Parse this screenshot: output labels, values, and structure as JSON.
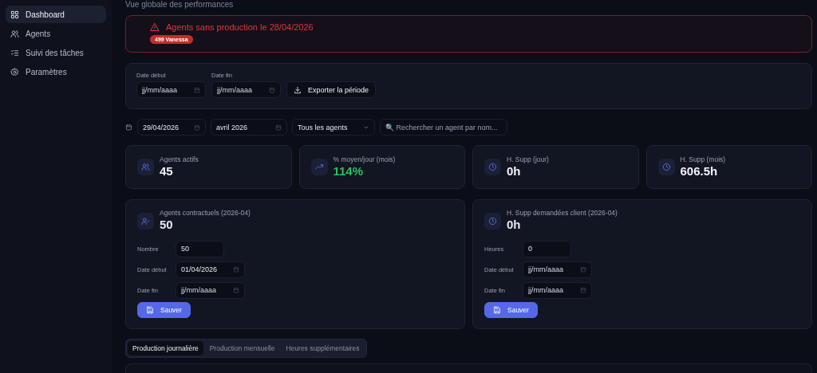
{
  "sidebar": {
    "items": [
      {
        "label": "Dashboard",
        "selected": true
      },
      {
        "label": "Agents",
        "selected": false
      },
      {
        "label": "Suivi des tâches",
        "selected": false
      },
      {
        "label": "Paramètres",
        "selected": false
      }
    ]
  },
  "header": {
    "subtitle": "Vue globale des performances"
  },
  "alert": {
    "title": "Agents sans production le 28/04/2026",
    "tags": [
      "499 Vanessa"
    ]
  },
  "export": {
    "fields": [
      {
        "label": "Date début",
        "placeholder": "jj/mm/aaaa"
      },
      {
        "label": "Date fin",
        "placeholder": "jj/mm/aaaa"
      }
    ],
    "button": "Exporter la période"
  },
  "filters": {
    "date": {
      "value": "29/04/2026"
    },
    "month": {
      "value": "avril 2026"
    },
    "agent_select": {
      "value": "Tous les agents"
    },
    "search": {
      "placeholder": "🔍 Rechercher un agent par nom..."
    }
  },
  "stats": [
    {
      "label": "Agents actifs",
      "value": "45",
      "color": "#f1f3f8"
    },
    {
      "label": "% moyen/jour (mois)",
      "value": "114%",
      "color": "#22c55e"
    },
    {
      "label": "H. Supp (jour)",
      "value": "0h",
      "color": "#f1f3f8"
    },
    {
      "label": "H. Supp (mois)",
      "value": "606.5h",
      "color": "#f1f3f8"
    }
  ],
  "forms": [
    {
      "title": "Agents contractuels (2026-04)",
      "value": "50",
      "fields": [
        {
          "label": "Nombre",
          "kind": "number",
          "value": "50"
        },
        {
          "label": "Date début",
          "kind": "date",
          "value": "01/04/2026"
        },
        {
          "label": "Date fin",
          "kind": "date",
          "placeholder": "jj/mm/aaaa"
        }
      ],
      "button": "Sauver"
    },
    {
      "title": "H. Supp demandées client (2026-04)",
      "value": "0h",
      "fields": [
        {
          "label": "Heures",
          "kind": "number",
          "value": "0"
        },
        {
          "label": "Date début",
          "kind": "date",
          "placeholder": "jj/mm/aaaa"
        },
        {
          "label": "Date fin",
          "kind": "date",
          "placeholder": "jj/mm/aaaa"
        }
      ],
      "button": "Sauver"
    }
  ],
  "tabs": [
    {
      "label": "Production journalière",
      "selected": true
    },
    {
      "label": "Production mensuelle",
      "selected": false
    },
    {
      "label": "Heures supplémentaires",
      "selected": false
    }
  ]
}
